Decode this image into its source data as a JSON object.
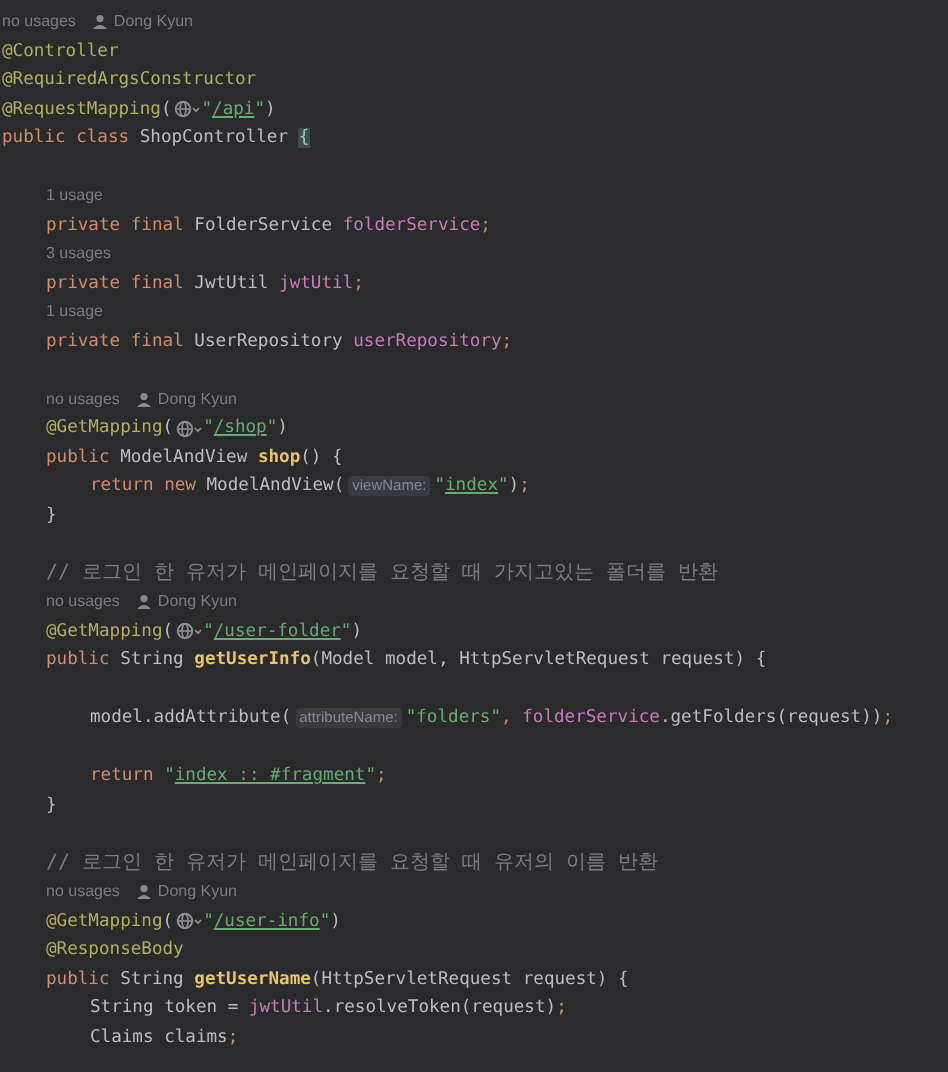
{
  "editor": {
    "lines": [
      {
        "kind": "hint",
        "usages": "no usages",
        "author": "Dong Kyun"
      },
      {
        "kind": "code",
        "tokens": [
          {
            "kind": "annotation",
            "text": "@Controller"
          }
        ]
      },
      {
        "kind": "code",
        "tokens": [
          {
            "kind": "annotation",
            "text": "@RequiredArgsConstructor"
          }
        ]
      },
      {
        "kind": "code",
        "tokens": [
          {
            "kind": "annotation",
            "text": "@RequestMapping"
          },
          {
            "kind": "plain",
            "text": "("
          },
          {
            "kind": "web_icon"
          },
          {
            "kind": "string",
            "text": "\""
          },
          {
            "kind": "link",
            "text": "/api"
          },
          {
            "kind": "string",
            "text": "\""
          },
          {
            "kind": "plain",
            "text": ")"
          }
        ]
      },
      {
        "kind": "code",
        "tokens": [
          {
            "kind": "keyword",
            "text": "public class "
          },
          {
            "kind": "plain",
            "text": "ShopController "
          },
          {
            "kind": "brace_match",
            "text": "{"
          }
        ],
        "children": [
          {
            "kind": "blank"
          },
          {
            "kind": "hint",
            "usages": "1 usage"
          },
          {
            "kind": "code",
            "tokens": [
              {
                "kind": "keyword",
                "text": "private final "
              },
              {
                "kind": "plain",
                "text": "FolderService "
              },
              {
                "kind": "field",
                "text": "folderService"
              },
              {
                "kind": "keyword",
                "text": ";"
              }
            ]
          },
          {
            "kind": "hint",
            "usages": "3 usages"
          },
          {
            "kind": "code",
            "tokens": [
              {
                "kind": "keyword",
                "text": "private final "
              },
              {
                "kind": "plain",
                "text": "JwtUtil "
              },
              {
                "kind": "field",
                "text": "jwtUtil"
              },
              {
                "kind": "keyword",
                "text": ";"
              }
            ]
          },
          {
            "kind": "hint",
            "usages": "1 usage"
          },
          {
            "kind": "code",
            "tokens": [
              {
                "kind": "keyword",
                "text": "private final "
              },
              {
                "kind": "plain",
                "text": "UserRepository "
              },
              {
                "kind": "field",
                "text": "userRepository"
              },
              {
                "kind": "keyword",
                "text": ";"
              }
            ]
          },
          {
            "kind": "blank"
          },
          {
            "kind": "hint",
            "usages": "no usages",
            "author": "Dong Kyun"
          },
          {
            "kind": "code",
            "tokens": [
              {
                "kind": "annotation",
                "text": "@GetMapping"
              },
              {
                "kind": "plain",
                "text": "("
              },
              {
                "kind": "web_icon"
              },
              {
                "kind": "string",
                "text": "\""
              },
              {
                "kind": "link",
                "text": "/shop"
              },
              {
                "kind": "string",
                "text": "\""
              },
              {
                "kind": "plain",
                "text": ")"
              }
            ]
          },
          {
            "kind": "code",
            "tokens": [
              {
                "kind": "keyword",
                "text": "public "
              },
              {
                "kind": "plain",
                "text": "ModelAndView "
              },
              {
                "kind": "method",
                "text": "shop"
              },
              {
                "kind": "plain",
                "text": "() {"
              }
            ],
            "children": [
              {
                "kind": "code",
                "tokens": [
                  {
                    "kind": "keyword",
                    "text": "return new "
                  },
                  {
                    "kind": "plain",
                    "text": "ModelAndView("
                  },
                  {
                    "kind": "param_hint",
                    "text": "viewName:"
                  },
                  {
                    "kind": "string",
                    "text": "\""
                  },
                  {
                    "kind": "link",
                    "text": "index"
                  },
                  {
                    "kind": "string",
                    "text": "\""
                  },
                  {
                    "kind": "plain",
                    "text": ")"
                  },
                  {
                    "kind": "keyword",
                    "text": ";"
                  }
                ]
              }
            ]
          },
          {
            "kind": "code",
            "tokens": [
              {
                "kind": "plain",
                "text": "}"
              }
            ]
          },
          {
            "kind": "blank"
          },
          {
            "kind": "comment",
            "text": "// 로그인 한 유저가 메인페이지를 요청할 때 가지고있는 폴더를 반환"
          },
          {
            "kind": "hint",
            "usages": "no usages",
            "author": "Dong Kyun"
          },
          {
            "kind": "code",
            "tokens": [
              {
                "kind": "annotation",
                "text": "@GetMapping"
              },
              {
                "kind": "plain",
                "text": "("
              },
              {
                "kind": "web_icon"
              },
              {
                "kind": "string",
                "text": "\""
              },
              {
                "kind": "link",
                "text": "/user-folder"
              },
              {
                "kind": "string",
                "text": "\""
              },
              {
                "kind": "plain",
                "text": ")"
              }
            ]
          },
          {
            "kind": "code",
            "tokens": [
              {
                "kind": "keyword",
                "text": "public "
              },
              {
                "kind": "plain",
                "text": "String "
              },
              {
                "kind": "method",
                "text": "getUserInfo"
              },
              {
                "kind": "plain",
                "text": "(Model model, HttpServletRequest request) {"
              }
            ],
            "children": [
              {
                "kind": "blank"
              },
              {
                "kind": "code",
                "tokens": [
                  {
                    "kind": "plain",
                    "text": "model.addAttribute("
                  },
                  {
                    "kind": "param_hint",
                    "text": "attributeName:"
                  },
                  {
                    "kind": "string",
                    "text": "\"folders\""
                  },
                  {
                    "kind": "keyword",
                    "text": ", "
                  },
                  {
                    "kind": "field",
                    "text": "folderService"
                  },
                  {
                    "kind": "plain",
                    "text": ".getFolders(request))"
                  },
                  {
                    "kind": "keyword",
                    "text": ";"
                  }
                ]
              },
              {
                "kind": "blank"
              },
              {
                "kind": "code",
                "tokens": [
                  {
                    "kind": "keyword",
                    "text": "return "
                  },
                  {
                    "kind": "string",
                    "text": "\""
                  },
                  {
                    "kind": "link",
                    "text": "index :: #fragment"
                  },
                  {
                    "kind": "string",
                    "text": "\""
                  },
                  {
                    "kind": "keyword",
                    "text": ";"
                  }
                ]
              }
            ]
          },
          {
            "kind": "code",
            "tokens": [
              {
                "kind": "plain",
                "text": "}"
              }
            ]
          },
          {
            "kind": "blank"
          },
          {
            "kind": "comment",
            "text": "// 로그인 한 유저가 메인페이지를 요청할 때 유저의 이름 반환"
          },
          {
            "kind": "hint",
            "usages": "no usages",
            "author": "Dong Kyun"
          },
          {
            "kind": "code",
            "tokens": [
              {
                "kind": "annotation",
                "text": "@GetMapping"
              },
              {
                "kind": "plain",
                "text": "("
              },
              {
                "kind": "web_icon"
              },
              {
                "kind": "string",
                "text": "\""
              },
              {
                "kind": "link",
                "text": "/user-info"
              },
              {
                "kind": "string",
                "text": "\""
              },
              {
                "kind": "plain",
                "text": ")"
              }
            ]
          },
          {
            "kind": "code",
            "tokens": [
              {
                "kind": "annotation",
                "text": "@ResponseBody"
              }
            ]
          },
          {
            "kind": "code",
            "tokens": [
              {
                "kind": "keyword",
                "text": "public "
              },
              {
                "kind": "plain",
                "text": "String "
              },
              {
                "kind": "method",
                "text": "getUserName"
              },
              {
                "kind": "plain",
                "text": "(HttpServletRequest request) {"
              }
            ],
            "children": [
              {
                "kind": "code",
                "tokens": [
                  {
                    "kind": "plain",
                    "text": "String token = "
                  },
                  {
                    "kind": "field",
                    "text": "jwtUtil"
                  },
                  {
                    "kind": "plain",
                    "text": ".resolveToken(request)"
                  },
                  {
                    "kind": "keyword",
                    "text": ";"
                  }
                ]
              },
              {
                "kind": "code",
                "tokens": [
                  {
                    "kind": "plain",
                    "text": "Claims claims"
                  },
                  {
                    "kind": "keyword",
                    "text": ";"
                  }
                ]
              }
            ]
          }
        ]
      }
    ]
  }
}
